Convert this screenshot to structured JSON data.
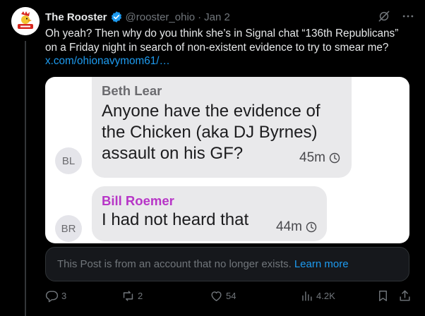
{
  "tweet": {
    "author_name": "The Rooster",
    "handle": "@rooster_ohio",
    "separator": "·",
    "date": "Jan 2",
    "text": "Oh yeah? Then why do you think she’s in Signal chat “136th Republicans” on a Friday night in search of non-existent evidence to try to smear me?",
    "link": "x.com/ohionavymom61/…"
  },
  "media": {
    "messages": [
      {
        "initials": "BL",
        "sender": "Beth Lear",
        "text": "Anyone have the evidence of the Chicken (aka DJ Byrnes) assault on his GF?",
        "time": "45m"
      },
      {
        "initials": "BR",
        "sender": "Bill Roemer",
        "text": "I had not heard that",
        "time": "44m"
      }
    ]
  },
  "notice": {
    "text": "This Post is from an account that no longer exists.",
    "link": "Learn more"
  },
  "actions": {
    "replies": "3",
    "reposts": "2",
    "likes": "54",
    "views": "4.2K"
  },
  "colors": {
    "accent": "#1d9bf0",
    "secondary_text": "#71767b",
    "sender_highlight": "#b735c7"
  }
}
